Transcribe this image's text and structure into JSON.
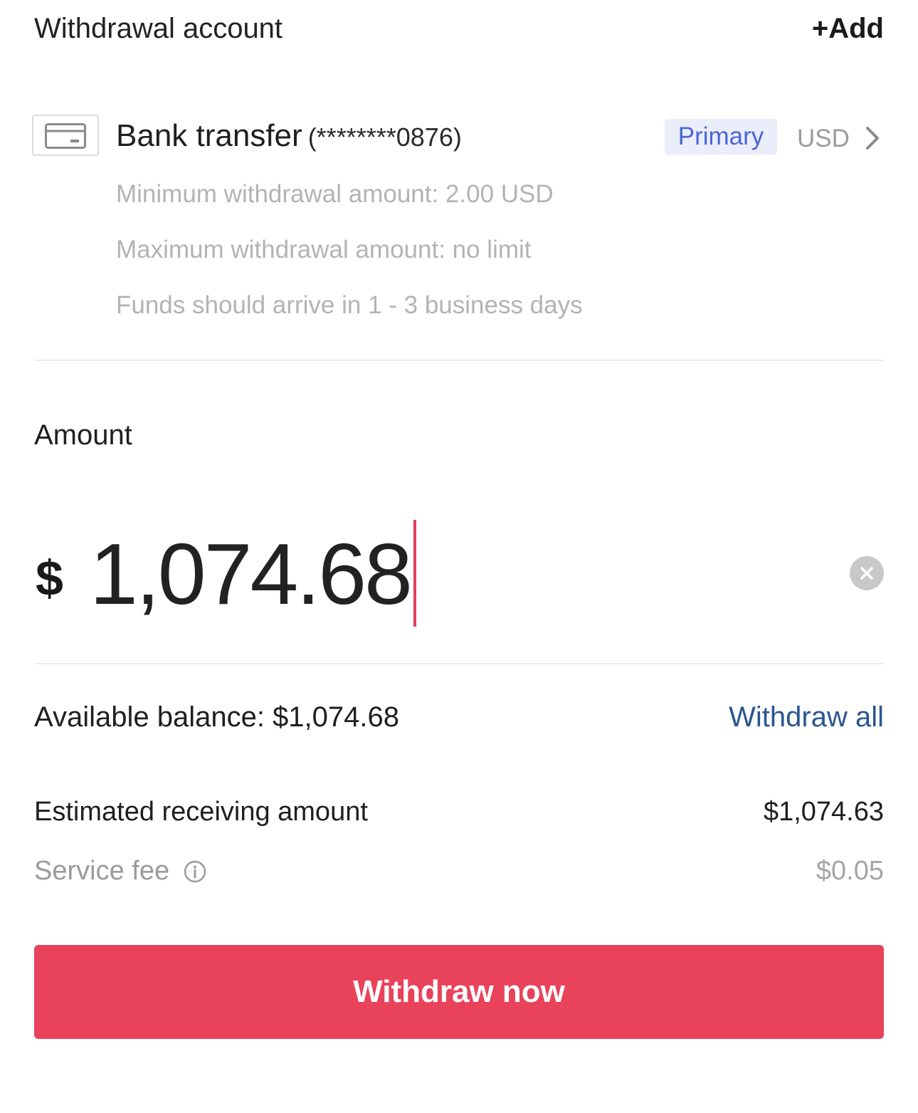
{
  "account_section": {
    "title": "Withdrawal account",
    "add_label": "+Add"
  },
  "bank_account": {
    "icon": "card-icon",
    "name": "Bank transfer",
    "masked_number": "(********0876)",
    "badge": "Primary",
    "currency": "USD",
    "min_amount": "Minimum withdrawal amount: 2.00 USD",
    "max_amount": "Maximum withdrawal amount: no limit",
    "arrival": "Funds should arrive in 1 - 3 business days"
  },
  "amount_section": {
    "label": "Amount",
    "currency_symbol": "$",
    "value": "1,074.68"
  },
  "balance": {
    "text": "Available balance: $1,074.68",
    "withdraw_all_label": "Withdraw all"
  },
  "estimate": {
    "label": "Estimated receiving amount",
    "value": "$1,074.63"
  },
  "fee": {
    "label": "Service fee",
    "value": "$0.05"
  },
  "submit": {
    "label": "Withdraw now"
  },
  "colors": {
    "accent": "#e8435b",
    "link": "#2b5590",
    "badge_bg": "#eaeefb",
    "badge_text": "#4a66d4"
  }
}
